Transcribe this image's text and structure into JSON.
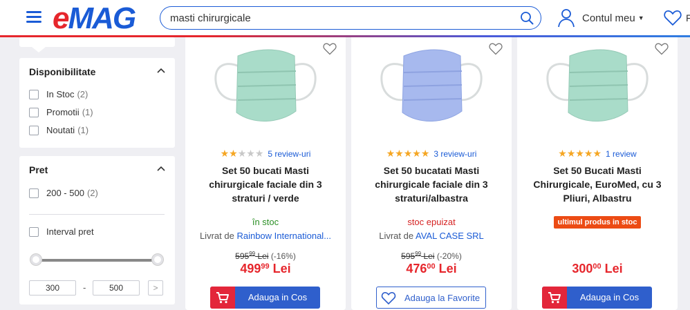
{
  "header": {
    "logo_e": "e",
    "logo_rest": "MAG",
    "search_value": "masti chirurgicale",
    "account_label": "Contul meu",
    "favorites_label_partial": "F"
  },
  "sidebar": {
    "availability": {
      "title": "Disponibilitate",
      "options": [
        {
          "label": "In Stoc",
          "count": "(2)"
        },
        {
          "label": "Promotii",
          "count": "(1)"
        },
        {
          "label": "Noutati",
          "count": "(1)"
        }
      ]
    },
    "price": {
      "title": "Pret",
      "options": [
        {
          "label": "200 - 500",
          "count": "(2)"
        }
      ],
      "interval_label": "Interval pret",
      "min_value": "300",
      "max_value": "500",
      "dash": "-"
    }
  },
  "products": [
    {
      "rating": 2,
      "reviews": "5 review-uri",
      "title": "Set 50 bucati Masti chirurgicale faciale din 3 straturi / verde",
      "stock": "în stoc",
      "seller_prefix": "Livrat de",
      "seller": "Rainbow International...",
      "old_price_int": "595",
      "old_price_dec": "99",
      "old_price_cur": "Lei",
      "discount": "(-16%)",
      "price_int": "499",
      "price_dec": "99",
      "price_cur": "Lei",
      "button": "Adauga in Cos",
      "mask_color": "#a9dcc9"
    },
    {
      "rating": 5,
      "reviews": "3 review-uri",
      "title": "Set 50 bucatati Masti chirurgicale faciale din 3 straturi/albastra",
      "stock": "stoc epuizat",
      "seller_prefix": "Livrat de",
      "seller": "AVAL CASE SRL",
      "old_price_int": "595",
      "old_price_dec": "99",
      "old_price_cur": "Lei",
      "discount": "(-20%)",
      "price_int": "476",
      "price_dec": "00",
      "price_cur": "Lei",
      "button": "Adauga la Favorite",
      "mask_color": "#a7b9ee"
    },
    {
      "rating": 5,
      "reviews": "1 review",
      "title": "Set 50 Bucati Masti Chirurgicale, EuroMed, cu 3 Pliuri, Albastru",
      "badge": "ultimul produs in stoc",
      "price_int": "300",
      "price_dec": "00",
      "price_cur": "Lei",
      "button": "Adauga in Cos",
      "mask_color": "#a9dcc9"
    }
  ],
  "colors": {
    "brand_red": "#e6262c",
    "brand_blue": "#1a5bd6",
    "button_blue": "#2f5fcc",
    "badge_orange": "#ec4b14",
    "star": "#f5a623"
  }
}
